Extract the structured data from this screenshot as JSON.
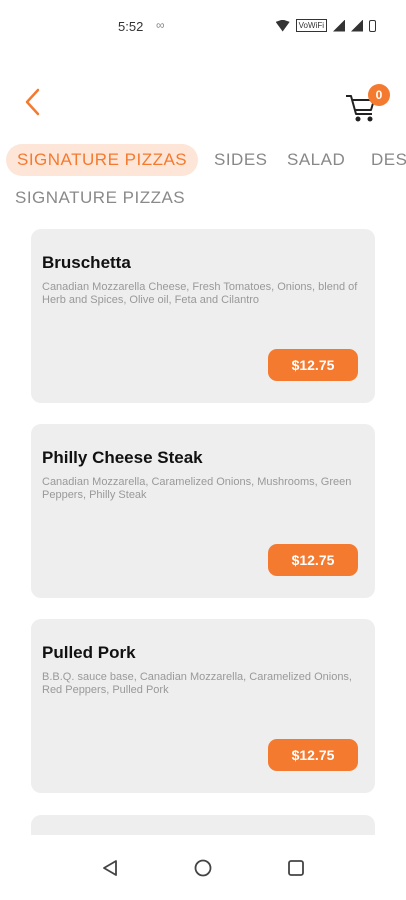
{
  "status_bar": {
    "time": "5:52",
    "infinity": "∞",
    "vowifi": "VoWiFi"
  },
  "header": {
    "cart_count": "0",
    "accent_color": "#f47a30"
  },
  "tabs": [
    {
      "label": "SIGNATURE PIZZAS",
      "active": true
    },
    {
      "label": "SIDES",
      "active": false
    },
    {
      "label": "SALAD",
      "active": false
    },
    {
      "label": "DESSERTS",
      "active": false
    }
  ],
  "section_title": "SIGNATURE PIZZAS",
  "items": [
    {
      "name": "Bruschetta",
      "description": "Canadian Mozzarella Cheese, Fresh Tomatoes, Onions, blend of Herb and Spices, Olive oil, Feta and Cilantro",
      "price": "$12.75"
    },
    {
      "name": "Philly Cheese Steak",
      "description": "Canadian Mozzarella, Caramelized Onions, Mushrooms, Green Peppers, Philly Steak",
      "price": "$12.75"
    },
    {
      "name": "Pulled Pork",
      "description": "B.B.Q. sauce base, Canadian Mozzarella, Caramelized Onions, Red Peppers, Pulled Pork",
      "price": "$12.75"
    }
  ],
  "icons": {
    "back": "back-chevron-icon",
    "cart": "shopping-cart-icon",
    "nav_back": "triangle-back-icon",
    "nav_home": "circle-home-icon",
    "nav_recents": "square-recents-icon"
  }
}
